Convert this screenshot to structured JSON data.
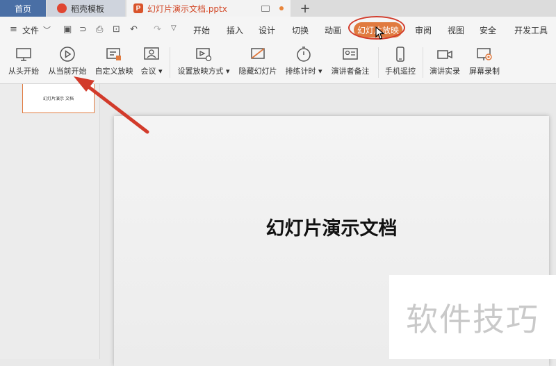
{
  "tabs": {
    "home": "首页",
    "template": "稻壳模板",
    "document": "幻灯片演示文档.pptx",
    "add": "+"
  },
  "menu": {
    "file": "文件",
    "items": [
      "开始",
      "插入",
      "设计",
      "切换",
      "动画",
      "幻灯片放映",
      "审阅",
      "视图",
      "安全",
      "开发工具"
    ],
    "active": "幻灯片放映"
  },
  "ribbon": {
    "from_start": "从头开始",
    "from_current": "从当前开始",
    "custom_show": "自定义放映",
    "meeting": "会议",
    "setup_show": "设置放映方式",
    "hide_slide": "隐藏幻灯片",
    "rehearse": "排练计时",
    "presenter_notes": "演讲者备注",
    "phone_remote": "手机遥控",
    "record_speech": "演讲实录",
    "screen_record": "屏幕录制"
  },
  "thumbnail": {
    "text": "幻灯片演示 文档"
  },
  "slide": {
    "title": "幻灯片演示文档"
  },
  "watermark": {
    "text": "软件技巧"
  },
  "colors": {
    "accent": "#e07a3f",
    "annotation": "#d23b2b",
    "home_tab": "#4a6fa5"
  }
}
